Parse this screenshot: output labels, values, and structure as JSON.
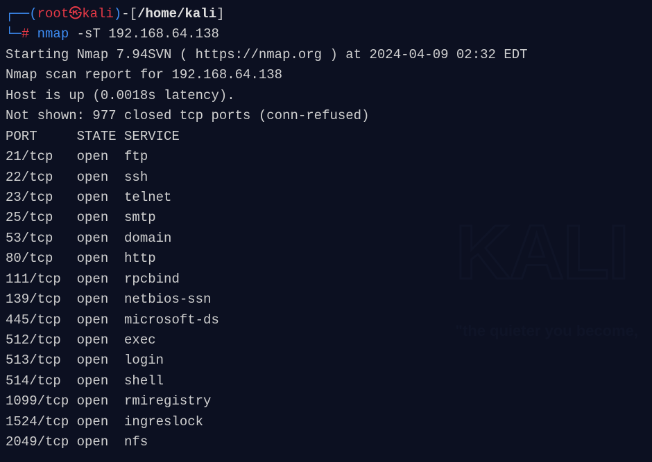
{
  "prompt": {
    "user": "root",
    "host": "kali",
    "cwd": "/home/kali",
    "symbol": "#"
  },
  "command": {
    "program": "nmap",
    "args": "-sT 192.168.64.138"
  },
  "output": {
    "starting": "Starting Nmap 7.94SVN ( https://nmap.org ) at 2024-04-09 02:32 EDT",
    "report": "Nmap scan report for 192.168.64.138",
    "host": "Host is up (0.0018s latency).",
    "notshown": "Not shown: 977 closed tcp ports (conn-refused)",
    "header": {
      "port": "PORT",
      "state": "STATE",
      "service": "SERVICE"
    },
    "rows": [
      {
        "port": "21/tcp",
        "state": "open",
        "service": "ftp"
      },
      {
        "port": "22/tcp",
        "state": "open",
        "service": "ssh"
      },
      {
        "port": "23/tcp",
        "state": "open",
        "service": "telnet"
      },
      {
        "port": "25/tcp",
        "state": "open",
        "service": "smtp"
      },
      {
        "port": "53/tcp",
        "state": "open",
        "service": "domain"
      },
      {
        "port": "80/tcp",
        "state": "open",
        "service": "http"
      },
      {
        "port": "111/tcp",
        "state": "open",
        "service": "rpcbind"
      },
      {
        "port": "139/tcp",
        "state": "open",
        "service": "netbios-ssn"
      },
      {
        "port": "445/tcp",
        "state": "open",
        "service": "microsoft-ds"
      },
      {
        "port": "512/tcp",
        "state": "open",
        "service": "exec"
      },
      {
        "port": "513/tcp",
        "state": "open",
        "service": "login"
      },
      {
        "port": "514/tcp",
        "state": "open",
        "service": "shell"
      },
      {
        "port": "1099/tcp",
        "state": "open",
        "service": "rmiregistry"
      },
      {
        "port": "1524/tcp",
        "state": "open",
        "service": "ingreslock"
      },
      {
        "port": "2049/tcp",
        "state": "open",
        "service": "nfs"
      }
    ]
  },
  "watermark": {
    "logo": "KALI",
    "tagline": "\"the quieter you become,"
  }
}
